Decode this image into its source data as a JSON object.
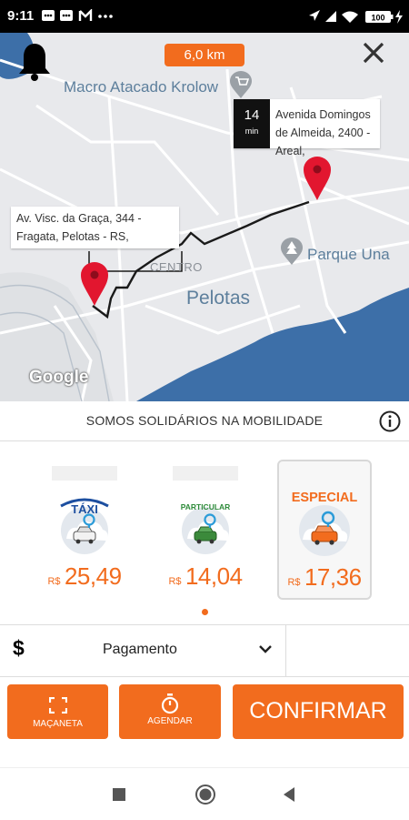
{
  "status_bar": {
    "time": "9:11",
    "battery": "100"
  },
  "map": {
    "distance": "6,0 km",
    "eta_value": "14",
    "eta_unit": "min",
    "destination_label": "Avenida Domingos de Almeida, 2400 - Areal,",
    "origin_label": "Av. Visc. da Graça, 344 - Fragata, Pelotas - RS,",
    "poi_macro": "Macro Atacado Krolow",
    "poi_parque": "Parque Una",
    "label_centro": "CENTRO",
    "label_city": "Pelotas",
    "google_logo": "Google"
  },
  "notice": {
    "text": "SOMOS SOLIDÁRIOS NA MOBILIDADE"
  },
  "ride_options": [
    {
      "badge": "TÁXI",
      "currency": "R$",
      "price": "25,49",
      "selected": false
    },
    {
      "badge": "PARTICULAR",
      "currency": "R$",
      "price": "14,04",
      "selected": false
    },
    {
      "badge": "ESPECIAL",
      "currency": "R$",
      "price": "17,36",
      "selected": true
    }
  ],
  "payment": {
    "label": "Pagamento",
    "currency_symbol": "$"
  },
  "actions": {
    "macaneta": "MAÇANETA",
    "agendar": "AGENDAR",
    "confirmar": "CONFIRMAR"
  },
  "colors": {
    "accent": "#f26c1e",
    "water": "#3d6fa8",
    "route": "#1a1a1a"
  },
  "icons": [
    "bell-icon",
    "close-icon",
    "info-icon",
    "dollar-icon",
    "chevron-down-icon",
    "fullscreen-icon",
    "timer-icon",
    "square-icon",
    "circle-icon",
    "back-icon"
  ]
}
